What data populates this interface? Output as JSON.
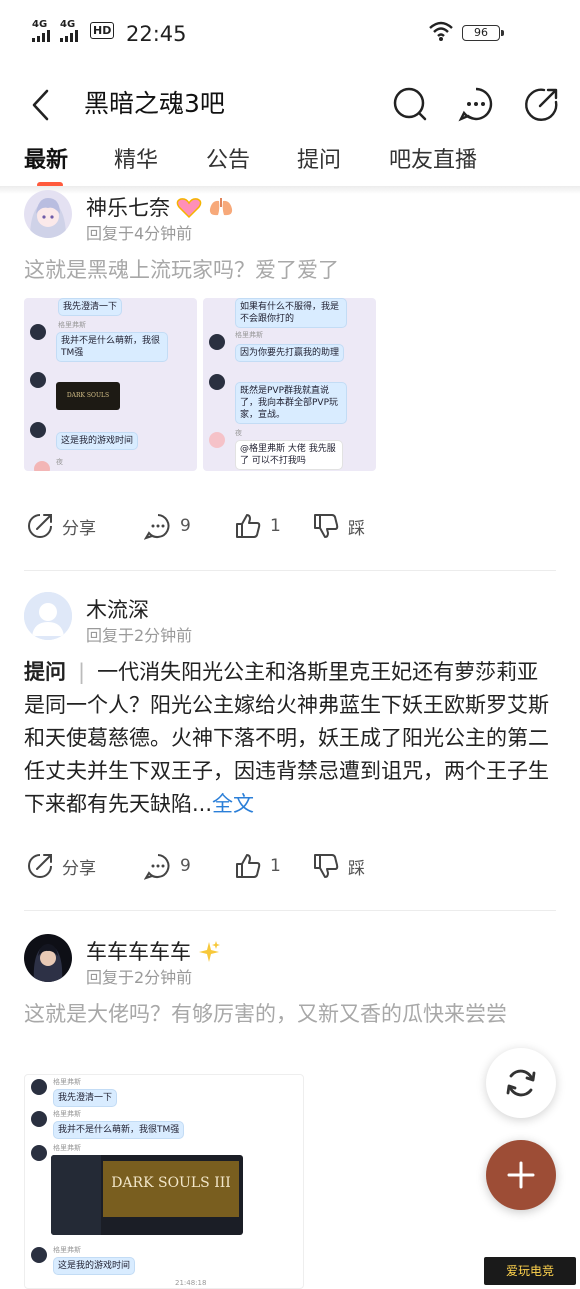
{
  "status_bar": {
    "signal1": "4G",
    "signal2": "4G",
    "hd": "HD",
    "time": "22:45",
    "battery": "96"
  },
  "header": {
    "title": "黑暗之魂3吧",
    "icons": [
      "back-icon",
      "search-icon",
      "more-icon",
      "share-icon"
    ]
  },
  "tabs": [
    {
      "label": "最新",
      "active": true
    },
    {
      "label": "精华",
      "active": false
    },
    {
      "label": "公告",
      "active": false
    },
    {
      "label": "提问",
      "active": false
    },
    {
      "label": "吧友直播",
      "active": false
    }
  ],
  "posts": [
    {
      "username": "神乐七奈",
      "time": "回复于4分钟前",
      "text": "这就是黑魂上流玩家吗？爱了爱了",
      "images": {
        "left": {
          "msg1": "我先澄清一下",
          "name": "格里弗斯",
          "msg2": "我并不是什么萌新，我很TM强",
          "game": "DARK SOULS",
          "msg3": "这是我的游戏时间",
          "name2": "夜"
        },
        "right": {
          "msg1": "如果有什么不服得，我是不会跟你打的",
          "name": "格里弗斯",
          "msg2": "因为你要先打赢我的助理",
          "msg3": "既然是PVP群我就直说了，我向本群全部PVP玩家，宣战。",
          "name2": "夜",
          "msg4": "@格里弗斯 大佬 我先服了 可以不打我吗"
        }
      },
      "actions": {
        "share": "分享",
        "comments": "9",
        "likes": "1",
        "dislike": "踩"
      }
    },
    {
      "username": "木流深",
      "time": "回复于2分钟前",
      "tag": "提问",
      "separator": "|",
      "text": "一代消失阳光公主和洛斯里克王妃还有萝莎莉亚是同一个人？阳光公主嫁给火神弗蓝生下妖王欧斯罗艾斯和天使葛慈德。火神下落不明，妖王成了阳光公主的第二任丈夫并生下双王子，因违背禁忌遭到诅咒，两个王子生下来都有先天缺陷...",
      "more": "全文",
      "actions": {
        "share": "分享",
        "comments": "9",
        "likes": "1",
        "dislike": "踩"
      }
    },
    {
      "username": "车车车车车",
      "time": "回复于2分钟前",
      "text": "这就是大佬吗？有够厉害的，又新又香的瓜快来尝尝",
      "image": {
        "name": "格里弗斯",
        "msg1": "我先澄清一下",
        "msg2": "我并不是什么萌新，我很TM强",
        "game": "DARK SOULS III",
        "msg3": "这是我的游戏时间",
        "timestamp": "21:48:18"
      }
    }
  ],
  "watermark": "爱玩电竞",
  "colors": {
    "accent": "#ff5a3c",
    "link": "#2b7fd8",
    "fab": "#9d4d36",
    "muted_text": "#a8a8a8"
  }
}
